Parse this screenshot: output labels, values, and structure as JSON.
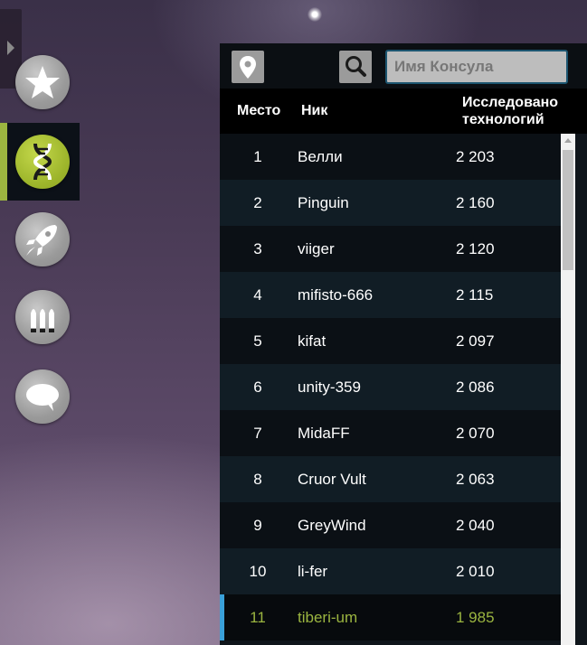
{
  "sidebar": {
    "items": [
      {
        "name": "star-icon",
        "active": false
      },
      {
        "name": "dna-icon",
        "active": true
      },
      {
        "name": "rocket-icon",
        "active": false
      },
      {
        "name": "ammo-icon",
        "active": false
      },
      {
        "name": "chat-bubble-icon",
        "active": false
      }
    ]
  },
  "search": {
    "placeholder": "Имя Консула",
    "value": ""
  },
  "table": {
    "headers": {
      "rank": "Место",
      "name": "Ник",
      "tech_line1": "Исследовано",
      "tech_line2": "технологий"
    },
    "rows": [
      {
        "rank": "1",
        "name": "Велли",
        "tech": "2 203"
      },
      {
        "rank": "2",
        "name": "Pinguin",
        "tech": "2 160"
      },
      {
        "rank": "3",
        "name": "viiger",
        "tech": "2 120"
      },
      {
        "rank": "4",
        "name": "mifisto-666",
        "tech": "2 115"
      },
      {
        "rank": "5",
        "name": "kifat",
        "tech": "2 097"
      },
      {
        "rank": "6",
        "name": "unity-359",
        "tech": "2 086"
      },
      {
        "rank": "7",
        "name": "MidaFF",
        "tech": "2 070"
      },
      {
        "rank": "8",
        "name": "Cruor Vult",
        "tech": "2 063"
      },
      {
        "rank": "9",
        "name": "GreyWind",
        "tech": "2 040"
      },
      {
        "rank": "10",
        "name": "li-fer",
        "tech": "2 010"
      },
      {
        "rank": "11",
        "name": "tiberi-um",
        "tech": "1 985"
      }
    ],
    "highlighted_rank": "11"
  },
  "colors": {
    "accent_green": "#9bb540",
    "highlight_bar": "#3aa0d9",
    "input_border": "#1c5570"
  }
}
